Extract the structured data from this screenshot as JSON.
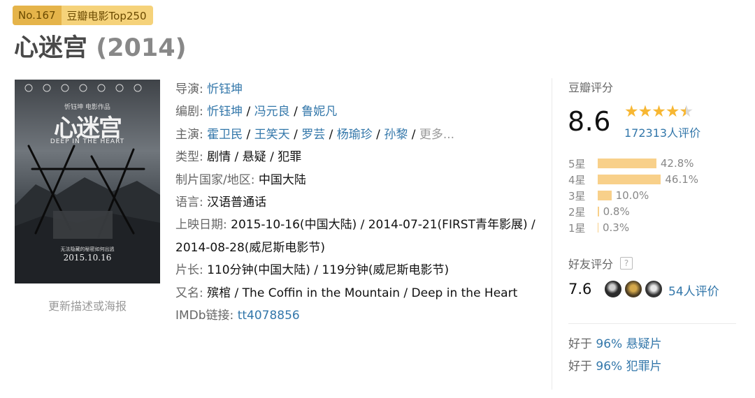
{
  "badge": {
    "rank": "No.167",
    "list": "豆瓣电影Top250"
  },
  "movie": {
    "title": "心迷宫",
    "year": "(2014)"
  },
  "poster": {
    "alt": "心迷宫 poster",
    "title_art": "心迷宫",
    "subtitle": "DEEP IN THE HEART",
    "tagline": "无法隐藏的秘密如何出逃",
    "date": "2015.10.16",
    "credit": "忻钰坤 电影作品"
  },
  "update_link": "更新描述或海报",
  "info": {
    "director": {
      "label": "导演:",
      "names": [
        "忻钰坤"
      ]
    },
    "writer": {
      "label": "编剧:",
      "names": [
        "忻钰坤",
        "冯元良",
        "鲁妮凡"
      ]
    },
    "cast": {
      "label": "主演:",
      "names": [
        "霍卫民",
        "王笑天",
        "罗芸",
        "杨瑜珍",
        "孙黎"
      ],
      "more": "更多..."
    },
    "genre": {
      "label": "类型:",
      "value": "剧情 / 悬疑 / 犯罪"
    },
    "country": {
      "label": "制片国家/地区:",
      "value": "中国大陆"
    },
    "language": {
      "label": "语言:",
      "value": "汉语普通话"
    },
    "release": {
      "label": "上映日期:",
      "value": "2015-10-16(中国大陆) / 2014-07-21(FIRST青年影展) / 2014-08-28(威尼斯电影节)"
    },
    "runtime": {
      "label": "片长:",
      "value": "110分钟(中国大陆) / 119分钟(威尼斯电影节)"
    },
    "aka": {
      "label": "又名:",
      "value": "殡棺 / The Coffin in the Mountain / Deep in the Heart"
    },
    "imdb": {
      "label": "IMDb链接:",
      "value": "tt4078856"
    }
  },
  "rating": {
    "title": "豆瓣评分",
    "score": "8.6",
    "stars": 4.5,
    "votes": "172313人评价",
    "distribution": [
      {
        "label": "5星",
        "percent": "42.8%",
        "value": 42.8
      },
      {
        "label": "4星",
        "percent": "46.1%",
        "value": 46.1
      },
      {
        "label": "3星",
        "percent": "10.0%",
        "value": 10.0
      },
      {
        "label": "2星",
        "percent": "0.8%",
        "value": 0.8
      },
      {
        "label": "1星",
        "percent": "0.3%",
        "value": 0.3
      }
    ]
  },
  "friends": {
    "title": "好友评分",
    "help_icon": "?",
    "score": "7.6",
    "votes": "54人评价"
  },
  "better_than": [
    {
      "prefix": "好于",
      "percent": "96%",
      "genre": "悬疑片"
    },
    {
      "prefix": "好于",
      "percent": "96%",
      "genre": "犯罪片"
    }
  ],
  "colors": {
    "link": "#3377aa",
    "star": "#f7b733",
    "bar": "#f8d08a",
    "badge": "#f5d27a"
  }
}
